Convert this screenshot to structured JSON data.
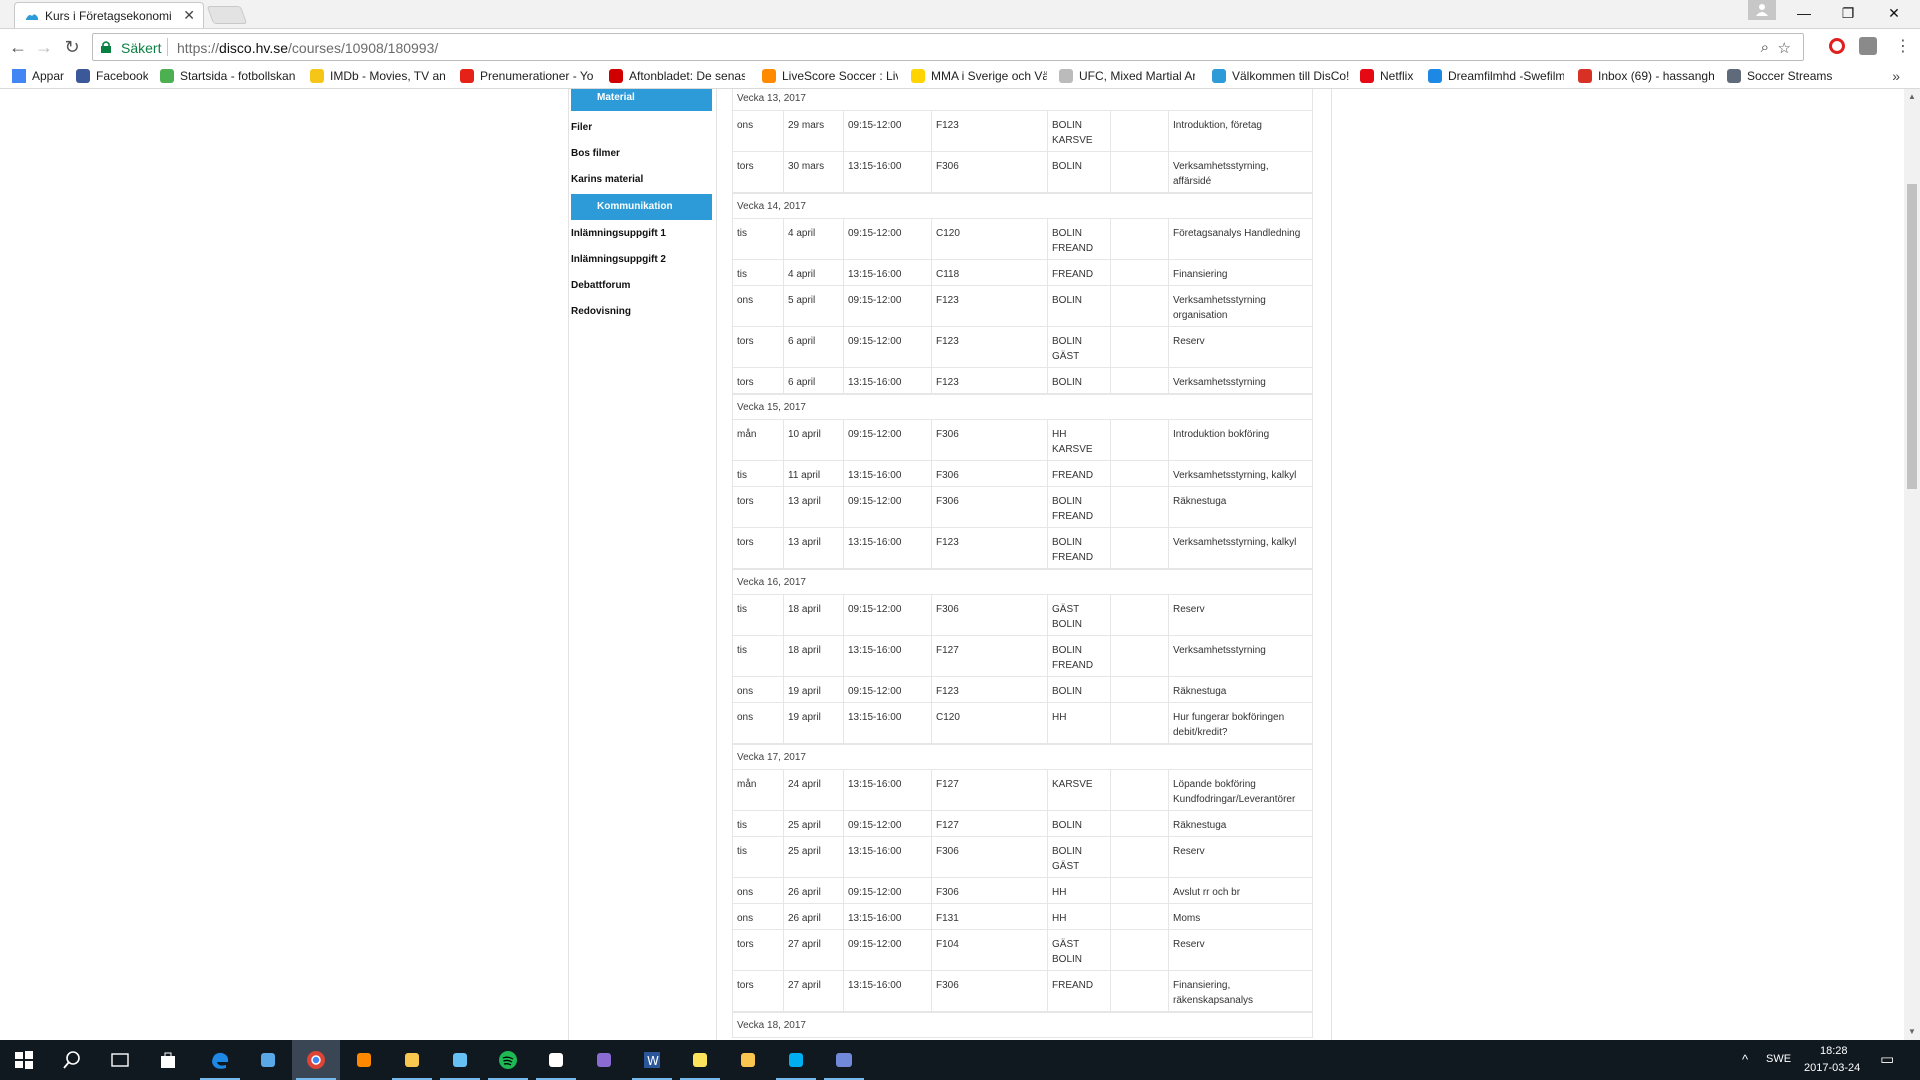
{
  "browser": {
    "tab": {
      "title": "Kurs i Företagsekonomi f"
    },
    "address": {
      "secure_label": "Säkert",
      "url_scheme": "https://",
      "url_host": "disco.hv.se",
      "url_path": "/courses/10908/180993/"
    },
    "bookmarks": [
      {
        "label": "Appar",
        "icon": "apps-grid-icon",
        "color": "#4285f4"
      },
      {
        "label": "Facebook",
        "icon": "facebook-icon",
        "color": "#3b5998"
      },
      {
        "label": "Startsida - fotbollskan",
        "icon": "fotboll-icon",
        "color": "#4caf50"
      },
      {
        "label": "IMDb - Movies, TV an",
        "icon": "imdb-icon",
        "color": "#f5c518"
      },
      {
        "label": "Prenumerationer - Yo",
        "icon": "youtube-icon",
        "color": "#e62117"
      },
      {
        "label": "Aftonbladet: De senas",
        "icon": "aftonbladet-icon",
        "color": "#d00000"
      },
      {
        "label": "LiveScore Soccer : Liv",
        "icon": "livescore-icon",
        "color": "#ff8a00"
      },
      {
        "label": "MMA i Sverige och Vä",
        "icon": "mma-icon",
        "color": "#ffd400"
      },
      {
        "label": "UFC, Mixed Martial Ar",
        "icon": "ufc-icon",
        "color": "#bbbbbb"
      },
      {
        "label": "Välkommen till DisCo!",
        "icon": "disco-icon",
        "color": "#2d9bd8"
      },
      {
        "label": "Netflix",
        "icon": "netflix-icon",
        "color": "#e50914"
      },
      {
        "label": "Dreamfilmhd -Swefilm",
        "icon": "dreamfilm-icon",
        "color": "#1e88e5"
      },
      {
        "label": "Inbox (69) - hassangh",
        "icon": "gmail-icon",
        "color": "#d93025"
      },
      {
        "label": "Soccer Streams",
        "icon": "reddit-icon",
        "color": "#5f6b7a"
      }
    ]
  },
  "sidebar": {
    "headings": {
      "material": "Material",
      "kommunikation": "Kommunikation"
    },
    "material_links": [
      "Filer",
      "Bos filmer",
      "Karins material"
    ],
    "kommunikation_links": [
      "Inlämningsuppgift 1",
      "Inlämningsuppgift 2",
      "Debattforum",
      "Redovisning"
    ]
  },
  "schedule": [
    {
      "week": "Vecka 13, 2017",
      "lessons": [
        {
          "day": "ons",
          "date": "29 mars",
          "time": "09:15-12:00",
          "room": "F123",
          "teachers": "BOLIN\nKARSVE",
          "topic": "Introduktion, företag"
        },
        {
          "day": "tors",
          "date": "30 mars",
          "time": "13:15-16:00",
          "room": "F306",
          "teachers": "BOLIN",
          "topic": "Verksamhetsstyrning,\naffärsidé"
        }
      ]
    },
    {
      "week": "Vecka 14, 2017",
      "lessons": [
        {
          "day": "tis",
          "date": "4 april",
          "time": "09:15-12:00",
          "room": "C120",
          "teachers": "BOLIN\nFREAND",
          "topic": "Företagsanalys Handledning"
        },
        {
          "day": "tis",
          "date": "4 april",
          "time": "13:15-16:00",
          "room": "C118",
          "teachers": "FREAND",
          "topic": "Finansiering"
        },
        {
          "day": "ons",
          "date": "5 april",
          "time": "09:15-12:00",
          "room": "F123",
          "teachers": "BOLIN",
          "topic": "Verksamhetsstyrning\norganisation"
        },
        {
          "day": "tors",
          "date": "6 april",
          "time": "09:15-12:00",
          "room": "F123",
          "teachers": "BOLIN\nGÄST",
          "topic": "Reserv"
        },
        {
          "day": "tors",
          "date": "6 april",
          "time": "13:15-16:00",
          "room": "F123",
          "teachers": "BOLIN",
          "topic": "Verksamhetsstyrning"
        }
      ]
    },
    {
      "week": "Vecka 15, 2017",
      "lessons": [
        {
          "day": "mån",
          "date": "10 april",
          "time": "09:15-12:00",
          "room": "F306",
          "teachers": "HH\nKARSVE",
          "topic": "Introduktion bokföring"
        },
        {
          "day": "tis",
          "date": "11 april",
          "time": "13:15-16:00",
          "room": "F306",
          "teachers": "FREAND",
          "topic": "Verksamhetsstyrning, kalkyl"
        },
        {
          "day": "tors",
          "date": "13 april",
          "time": "09:15-12:00",
          "room": "F306",
          "teachers": "BOLIN\nFREAND",
          "topic": "Räknestuga"
        },
        {
          "day": "tors",
          "date": "13 april",
          "time": "13:15-16:00",
          "room": "F123",
          "teachers": "BOLIN\nFREAND",
          "topic": "Verksamhetsstyrning, kalkyl"
        }
      ]
    },
    {
      "week": "Vecka 16, 2017",
      "lessons": [
        {
          "day": "tis",
          "date": "18 april",
          "time": "09:15-12:00",
          "room": "F306",
          "teachers": "GÄST\nBOLIN",
          "topic": "Reserv"
        },
        {
          "day": "tis",
          "date": "18 april",
          "time": "13:15-16:00",
          "room": "F127",
          "teachers": "BOLIN\nFREAND",
          "topic": "Verksamhetsstyrning"
        },
        {
          "day": "ons",
          "date": "19 april",
          "time": "09:15-12:00",
          "room": "F123",
          "teachers": "BOLIN",
          "topic": "Räknestuga"
        },
        {
          "day": "ons",
          "date": "19 april",
          "time": "13:15-16:00",
          "room": "C120",
          "teachers": "HH",
          "topic": "Hur fungerar bokföringen\ndebit/kredit?"
        }
      ]
    },
    {
      "week": "Vecka 17, 2017",
      "lessons": [
        {
          "day": "mån",
          "date": "24 april",
          "time": "13:15-16:00",
          "room": "F127",
          "teachers": "KARSVE",
          "topic": "Löpande bokföring\nKundfodringar/Leverantörer"
        },
        {
          "day": "tis",
          "date": "25 april",
          "time": "09:15-12:00",
          "room": "F127",
          "teachers": "BOLIN",
          "topic": "Räknestuga"
        },
        {
          "day": "tis",
          "date": "25 april",
          "time": "13:15-16:00",
          "room": "F306",
          "teachers": "BOLIN\nGÄST",
          "topic": "Reserv"
        },
        {
          "day": "ons",
          "date": "26 april",
          "time": "09:15-12:00",
          "room": "F306",
          "teachers": "HH",
          "topic": "Avslut rr och br"
        },
        {
          "day": "ons",
          "date": "26 april",
          "time": "13:15-16:00",
          "room": "F131",
          "teachers": "HH",
          "topic": "Moms"
        },
        {
          "day": "tors",
          "date": "27 april",
          "time": "09:15-12:00",
          "room": "F104",
          "teachers": "GÄST\nBOLIN",
          "topic": "Reserv"
        },
        {
          "day": "tors",
          "date": "27 april",
          "time": "13:15-16:00",
          "room": "F306",
          "teachers": "FREAND",
          "topic": "Finansiering,\nräkenskapsanalys"
        }
      ]
    },
    {
      "week": "Vecka 18, 2017",
      "lessons": []
    }
  ],
  "taskbar": {
    "apps": [
      {
        "name": "search-icon",
        "color": "#ffffff"
      },
      {
        "name": "task-view-icon",
        "color": "#ffffff"
      },
      {
        "name": "store-icon",
        "color": "#ffffff"
      },
      {
        "name": "edge-icon",
        "color": "#1e88e5"
      },
      {
        "name": "ubisoft-icon",
        "color": "#5aa9e6"
      },
      {
        "name": "chrome-icon",
        "color": "#db4437"
      },
      {
        "name": "vlc-icon",
        "color": "#ff8800"
      },
      {
        "name": "file-explorer-icon",
        "color": "#f9c74f"
      },
      {
        "name": "steam-icon",
        "color": "#66c0f4"
      },
      {
        "name": "spotify-icon",
        "color": "#1db954"
      },
      {
        "name": "mail-icon",
        "color": "#ffffff"
      },
      {
        "name": "firefox-dev-icon",
        "color": "#8a6bd1"
      },
      {
        "name": "word-icon",
        "color": "#2b579a"
      },
      {
        "name": "sticky-notes-icon",
        "color": "#fbe35c"
      },
      {
        "name": "notepad-icon",
        "color": "#f9c74f"
      },
      {
        "name": "skype-icon",
        "color": "#00aff0"
      },
      {
        "name": "discord-icon",
        "color": "#7289da"
      }
    ],
    "language": "SWE",
    "time": "18:28",
    "date": "2017-03-24"
  }
}
